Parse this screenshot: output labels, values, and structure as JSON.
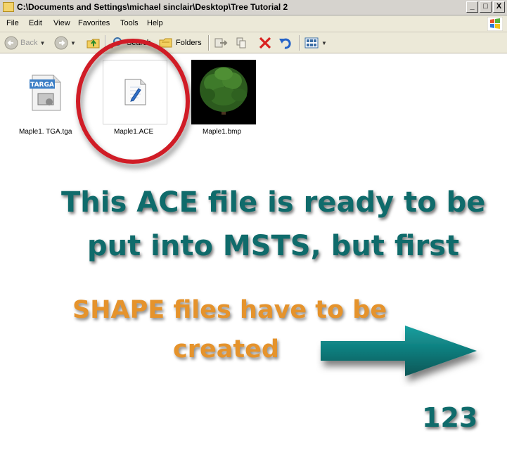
{
  "window": {
    "title": "C:\\Documents and Settings\\michael sinclair\\Desktop\\Tree Tutorial 2",
    "buttons": {
      "minimize": "_",
      "maximize": "□",
      "close": "X"
    }
  },
  "menubar": {
    "items": [
      "File",
      "Edit",
      "View",
      "Favorites",
      "Tools",
      "Help"
    ]
  },
  "toolbar": {
    "back_label": "Back",
    "search_label": "Search",
    "folders_label": "Folders"
  },
  "files": [
    {
      "name": "Maple1. TGA.tga",
      "icon": "targa-file-icon",
      "badge": "TARGA"
    },
    {
      "name": "Maple1.ACE",
      "icon": "ace-file-icon"
    },
    {
      "name": "Maple1.bmp",
      "icon": "tree-thumbnail"
    }
  ],
  "overlay": {
    "line1": "This ACE file is ready to be",
    "line2": "put into MSTS, but first",
    "line3": "SHAPE files have to be",
    "line4": "created",
    "page_number": "123"
  },
  "colors": {
    "teal": "#0f6b6b",
    "orange": "#e5932c",
    "circle": "#d01f25",
    "arrow": "#0e7b7b"
  }
}
